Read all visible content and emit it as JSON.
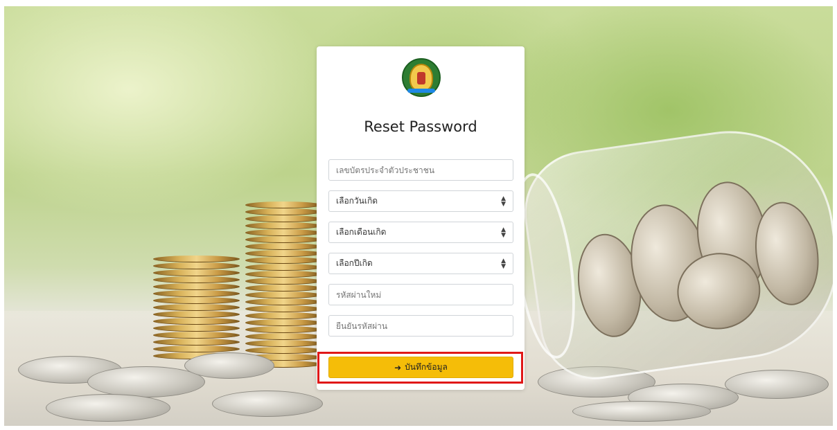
{
  "form": {
    "title": "Reset Password",
    "id_card_placeholder": "เลขบัตรประจำตัวประชาชน",
    "birth_day": {
      "selected": "เลือกวันเกิด"
    },
    "birth_month": {
      "selected": "เลือกเดือนเกิด"
    },
    "birth_year": {
      "selected": "เลือกปีเกิด"
    },
    "new_password_placeholder": "รหัสผ่านใหม่",
    "confirm_password_placeholder": "ยืนยันรหัสผ่าน",
    "save_label": "บันทึกข้อมูล"
  },
  "icons": {
    "save": "sign-in-icon",
    "select_caret": "sort-caret-icon"
  },
  "colors": {
    "save_button": "#f5bd08",
    "highlight_outline": "#e01818"
  }
}
